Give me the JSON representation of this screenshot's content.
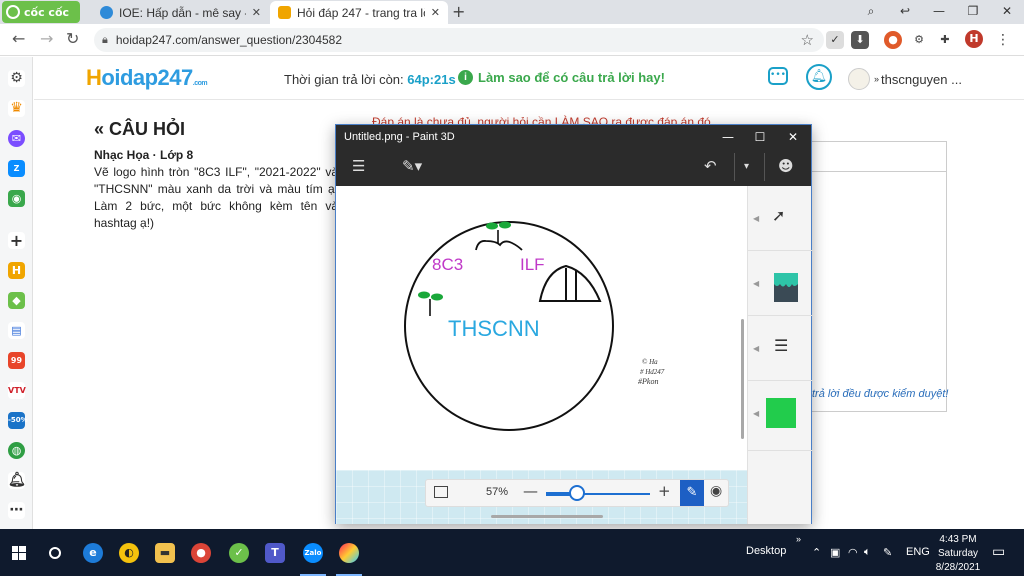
{
  "browser": {
    "brand": "cốc cốc",
    "tabs": [
      {
        "label": "IOE: Hấp dẫn - mê say - thấy",
        "active": false
      },
      {
        "label": "Hỏi đáp 247 - trang tra lời",
        "active": true
      }
    ],
    "new_tab": "+",
    "url": "hoidap247.com/answer_question/2304582",
    "profile_initial": "H"
  },
  "site": {
    "logo_h": "H",
    "logo_rest": "oidap247",
    "logo_com": ".com",
    "timer_label": "Thời gian trả lời còn:",
    "timer_value": "64p:21s",
    "hint": "Làm sao để có câu trả lời hay!",
    "username": "thscnguyen ..."
  },
  "question": {
    "heading": "« CÂU HỎI",
    "subject": "Nhạc Họa · Lớp 8",
    "body": "Vẽ logo hình tròn \"8C3 ILF\", \"2021-2022\" và \"THCSNN\" màu xanh da trời và màu tím ạ! Làm 2 bức, một bức không kèm tên và hashtag ạ!)",
    "note": "Đáp án là chưa đủ, người hỏi cần LÀM SAO ra được đáp án đó",
    "reviewed": "trả lời đều được kiểm duyệt!"
  },
  "paint3d": {
    "title": "Untitled.png - Paint 3D",
    "zoom_label": "57%",
    "zoom_fraction": 0.3,
    "drawing": {
      "left_text": "8C3",
      "right_text": "ILF",
      "center_text": "THSCNN",
      "signature_lines": [
        "© Ha",
        "# Hd247",
        "#Pkon"
      ]
    },
    "side_color": "#22cc4c"
  },
  "taskbar": {
    "desktop_label": "Desktop",
    "lang": "ENG",
    "time": "4:43 PM",
    "day": "Saturday",
    "date": "8/28/2021"
  },
  "colors": {
    "accent": "#1aa0c8",
    "hint_green": "#3aa84c",
    "note_red": "#c0392b",
    "purple_text": "#c038c8",
    "cyan_text": "#2aa8e0"
  }
}
